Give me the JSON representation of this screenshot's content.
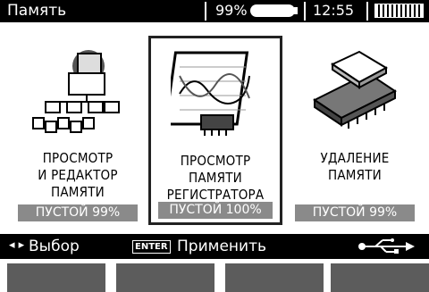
{
  "header": {
    "title": "Память",
    "battery_percent": "99%",
    "clock": "12:55"
  },
  "cards": [
    {
      "label_lines": [
        "ПРОСМОТР",
        "И РЕДАКТОР",
        "ПАМЯТИ"
      ],
      "status": "ПУСТОЙ 99%",
      "selected": false,
      "icon": "memory-tree-icon"
    },
    {
      "label_lines": [
        "ПРОСМОТР",
        "ПАМЯТИ",
        "РЕГИСТРАТОРА"
      ],
      "status": "ПУСТОЙ 100%",
      "selected": true,
      "icon": "recorder-chart-icon"
    },
    {
      "label_lines": [
        "УДАЛЕНИЕ",
        "ПАМЯТИ"
      ],
      "status": "ПУСТОЙ 99%",
      "selected": false,
      "icon": "memory-chip-erase-icon"
    }
  ],
  "hints": {
    "arrows": "◂ ▸",
    "select_label": "Выбор",
    "enter_key": "ENTER",
    "apply_label": "Применить",
    "usb_icon": "usb-icon"
  },
  "softkeys_count": 4
}
